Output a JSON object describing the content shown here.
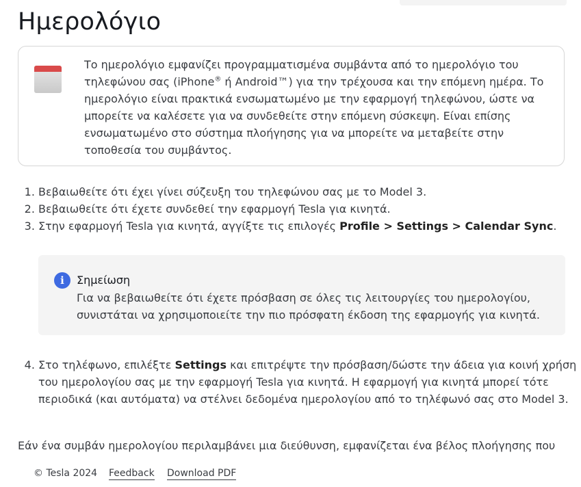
{
  "page": {
    "title": "Ημερολόγιο"
  },
  "intro": {
    "icon": "calendar-icon",
    "text_part1": "Το ημερολόγιο εμφανίζει προγραμματισμένα συμβάντα από το ημερολόγιο του τηλεφώνου σας (iPhone",
    "reg_mark": "®",
    "text_part2": " ή Android™) για την τρέχουσα και την επόμενη ημέρα. Το ημερολόγιο είναι πρακτικά ενσωματωμένο με την εφαρμογή τηλεφώνου, ώστε να μπορείτε να καλέσετε για να συνδεθείτε στην επόμενη σύσκεψη. Είναι επίσης ενσωματωμένο στο σύστημα πλοήγησης για να μπορείτε να μεταβείτε στην τοποθεσία του συμβάντος."
  },
  "steps": [
    {
      "text": "Βεβαιωθείτε ότι έχει γίνει σύζευξη του τηλεφώνου σας με το Model 3."
    },
    {
      "text": "Βεβαιωθείτε ότι έχετε συνδεθεί την εφαρμογή Tesla για κινητά."
    },
    {
      "prefix": "Στην εφαρμογή Tesla για κινητά, αγγίξτε τις επιλογές ",
      "bold": "Profile > Settings > Calendar Sync",
      "suffix": "."
    }
  ],
  "note": {
    "icon": "info-icon",
    "title": "Σημείωση",
    "body": "Για να βεβαιωθείτε ότι έχετε πρόσβαση σε όλες τις λειτουργίες του ημερολογίου, συνιστάται να χρησιμοποιείτε την πιο πρόσφατη έκδοση της εφαρμογής για κινητά."
  },
  "step4": {
    "prefix": "Στο τηλέφωνο, επιλέξτε ",
    "bold": "Settings",
    "suffix": " και επιτρέψτε την πρόσβαση/δώστε την άδεια για κοινή χρήση του ημερολογίου σας με την εφαρμογή Tesla για κινητά. Η εφαρμογή για κινητά μπορεί τότε περιοδικά (και αυτόματα) να στέλνει δεδομένα ημερολογίου από το τηλέφωνό σας στο Model 3."
  },
  "trailing": {
    "text": "Εάν ένα συμβάν ημερολογίου περιλαμβάνει μια διεύθυνση, εμφανίζεται ένα βέλος πλοήγησης που"
  },
  "footer": {
    "copyright": "© Tesla 2024",
    "feedback": "Feedback",
    "download": "Download PDF"
  },
  "colors": {
    "accent": "#3e6ae1",
    "calendar_red": "#d94a4a",
    "note_bg": "#f4f4f4"
  }
}
